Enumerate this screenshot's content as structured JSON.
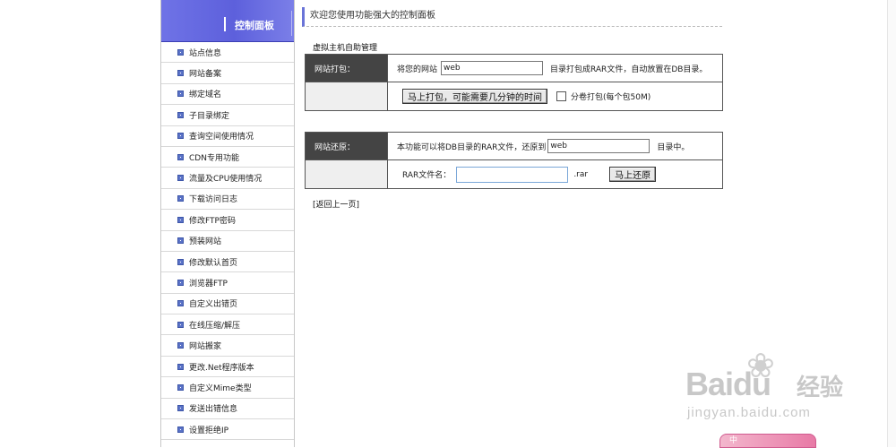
{
  "sidebar": {
    "title": "控制面板",
    "items": [
      {
        "label": "站点信息"
      },
      {
        "label": "网站备案"
      },
      {
        "label": "绑定域名"
      },
      {
        "label": "子目录绑定"
      },
      {
        "label": "查询空间使用情况"
      },
      {
        "label": "CDN专用功能"
      },
      {
        "label": "流量及CPU使用情况"
      },
      {
        "label": "下载访问日志"
      },
      {
        "label": "修改FTP密码"
      },
      {
        "label": "预装网站"
      },
      {
        "label": "修改默认首页"
      },
      {
        "label": "浏览器FTP"
      },
      {
        "label": "自定义出错页"
      },
      {
        "label": "在线压缩/解压"
      },
      {
        "label": "网站搬家"
      },
      {
        "label": "更改.Net程序版本"
      },
      {
        "label": "自定义Mime类型"
      },
      {
        "label": "发送出错信息"
      },
      {
        "label": "设置拒绝IP"
      }
    ]
  },
  "main": {
    "welcome": "欢迎您使用功能强大的控制面板",
    "section_title": "虚拟主机自助管理",
    "pack": {
      "label": "网站打包：",
      "prefix": "将您的网站",
      "input_value": "web",
      "suffix": "目录打包成RAR文件，自动放置在DB目录。",
      "button": "马上打包，可能需要几分钟的时间",
      "checkbox_label": "分卷打包(每个包50M)"
    },
    "restore": {
      "label": "网站还原：",
      "prefix": "本功能可以将DB目录的RAR文件，还原到",
      "input_value": "web",
      "suffix": "目录中。",
      "rar_label": "RAR文件名：",
      "rar_value": "",
      "ext": ".rar",
      "button": "马上还原"
    },
    "back_link": "[返回上一页]"
  },
  "watermark": {
    "brand": "Bai",
    "brand2": "du",
    "cn": "经验",
    "url": "jingyan.baidu.com"
  },
  "corner_widget": {
    "label": "中"
  }
}
